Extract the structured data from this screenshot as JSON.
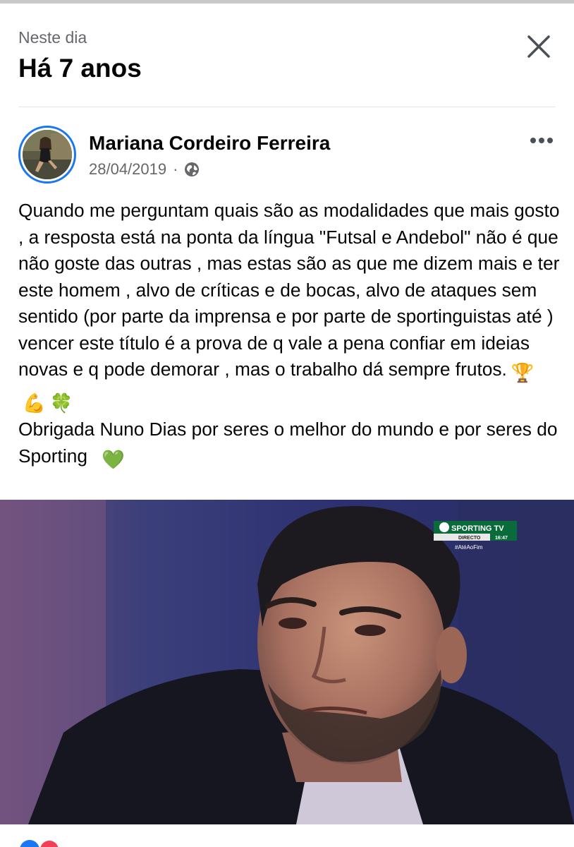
{
  "memories_header": {
    "subtitle": "Neste dia",
    "title": "Há 7 anos"
  },
  "post": {
    "author": "Mariana Cordeiro Ferreira",
    "date": "28/04/2019",
    "separator": "·",
    "privacy_icon": "globe-icon",
    "text": "Quando me perguntam quais são as modalidades que mais gosto , a resposta está na ponta da língua \"Futsal e Andebol\" não é que não goste das outras , mas estas são as que me dizem mais e ter este homem , alvo de críticas e de bocas, alvo de ataques sem sentido (por parte da imprensa e por parte de sportinguistas até ) vencer este título é a prova de q vale a pena confiar em ideias novas e q pode demorar , mas o trabalho dá sempre frutos.",
    "text_2": "Obrigada Nuno Dias por seres o melhor do mundo e por seres do Sporting",
    "emoji_trophy": "🏆",
    "emoji_muscle": "💪",
    "emoji_clover": "🍀",
    "emoji_heart": "💚",
    "image": {
      "tv_logo": "SPORTING TV",
      "directo": "DIRECTO",
      "time": "16:47",
      "hashtag": "#AtéAoFim"
    }
  },
  "colors": {
    "accent": "#1877f2",
    "secondary_text": "#65676b",
    "sporting_green": "#00a651"
  }
}
